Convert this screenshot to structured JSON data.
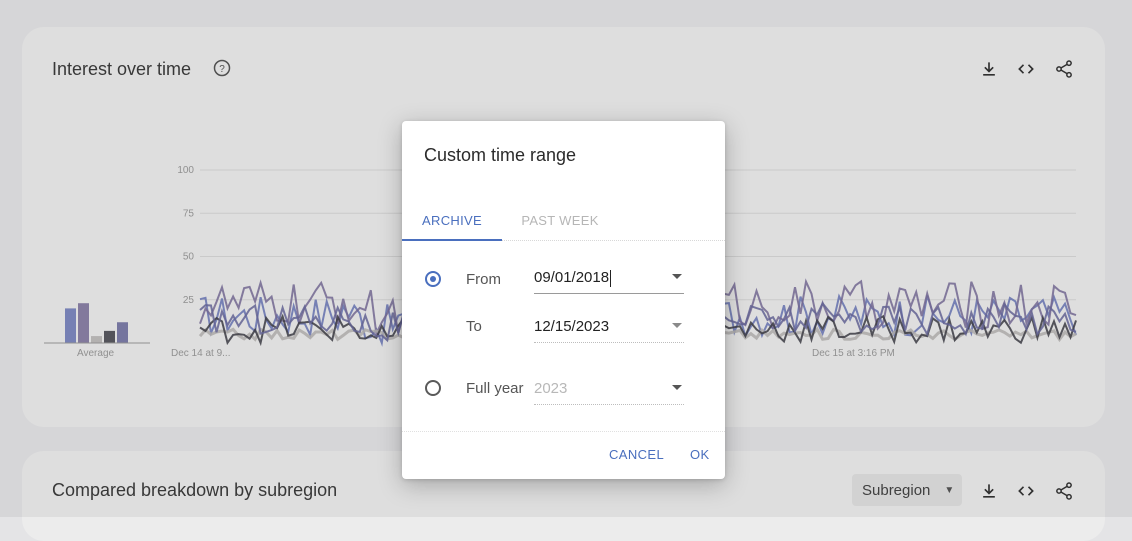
{
  "card1": {
    "title": "Interest over time"
  },
  "card2": {
    "title": "Compared breakdown by subregion",
    "select_label": "Subregion"
  },
  "icons": {
    "help": "help-circle-icon",
    "download": "download-icon",
    "embed": "code-icon",
    "share": "share-icon"
  },
  "chart_data": {
    "type": "line",
    "yticks": [
      "100",
      "75",
      "50",
      "25"
    ],
    "ylim": [
      0,
      100
    ],
    "x_labels": [
      "Dec 14 at 9...",
      "Dec 15 at 3:16 PM"
    ],
    "average_label": "Average",
    "average_bars": [
      {
        "value": 20,
        "color": "#6b78b8"
      },
      {
        "value": 23,
        "color": "#7a6f9a"
      },
      {
        "value": 4,
        "color": "#b7b5b3"
      },
      {
        "value": 7,
        "color": "#3f3f48"
      },
      {
        "value": 12,
        "color": "#6a6a9c"
      }
    ],
    "series": [
      {
        "color": "#6b78b8"
      },
      {
        "color": "#7a6f9a"
      },
      {
        "color": "#b7b5b3"
      },
      {
        "color": "#3f3f48"
      },
      {
        "color": "#6a6a9c"
      }
    ]
  },
  "dialog": {
    "title": "Custom time range",
    "tabs": [
      "ARCHIVE",
      "PAST WEEK"
    ],
    "from_label": "From",
    "from_value": "09/01/2018",
    "to_label": "To",
    "to_value": "12/15/2023",
    "full_year_label": "Full year",
    "full_year_value": "2023",
    "cancel_label": "CANCEL",
    "ok_label": "OK"
  }
}
